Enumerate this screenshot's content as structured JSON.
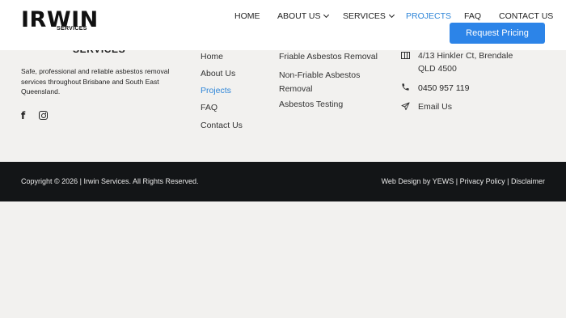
{
  "header": {
    "logo_main": "IRWIN",
    "logo_sub": "SERVICES",
    "nav": [
      {
        "label": "HOME"
      },
      {
        "label": "ABOUT US"
      },
      {
        "label": "SERVICES"
      },
      {
        "label": "PROJECTS"
      },
      {
        "label": "FAQ"
      },
      {
        "label": "CONTACT US"
      }
    ],
    "cta": "Request Pricing",
    "accent_color": "#2c84e8",
    "active_link_color": "#2f86d8"
  },
  "footer": {
    "brand_partial": "SERVICES",
    "about_text": "Safe, professional and reliable asbestos removal services throughout Brisbane and South East Queensland.",
    "social": [
      {
        "icon": "facebook-icon"
      },
      {
        "icon": "instagram-icon"
      }
    ],
    "quick_links": [
      "Home",
      "About Us",
      "Projects",
      "FAQ",
      "Contact Us"
    ],
    "services": [
      "Friable Asbestos Removal",
      "Non-Friable Asbestos Removal",
      "Asbestos Testing"
    ],
    "contact": {
      "address_line1": "4/13 Hinkler Ct, Brendale",
      "address_line2": "QLD 4500",
      "phone": "0450 957 119",
      "email": "Email Us"
    }
  },
  "bottom_bar": {
    "copyright": "Copyright © 2026 | Irwin Services. All Rights Reserved.",
    "web_design": "Web Design by YEWS",
    "privacy": "Privacy Policy",
    "disclaimer": "Disclaimer",
    "separator": " | ",
    "background": "#131517"
  }
}
